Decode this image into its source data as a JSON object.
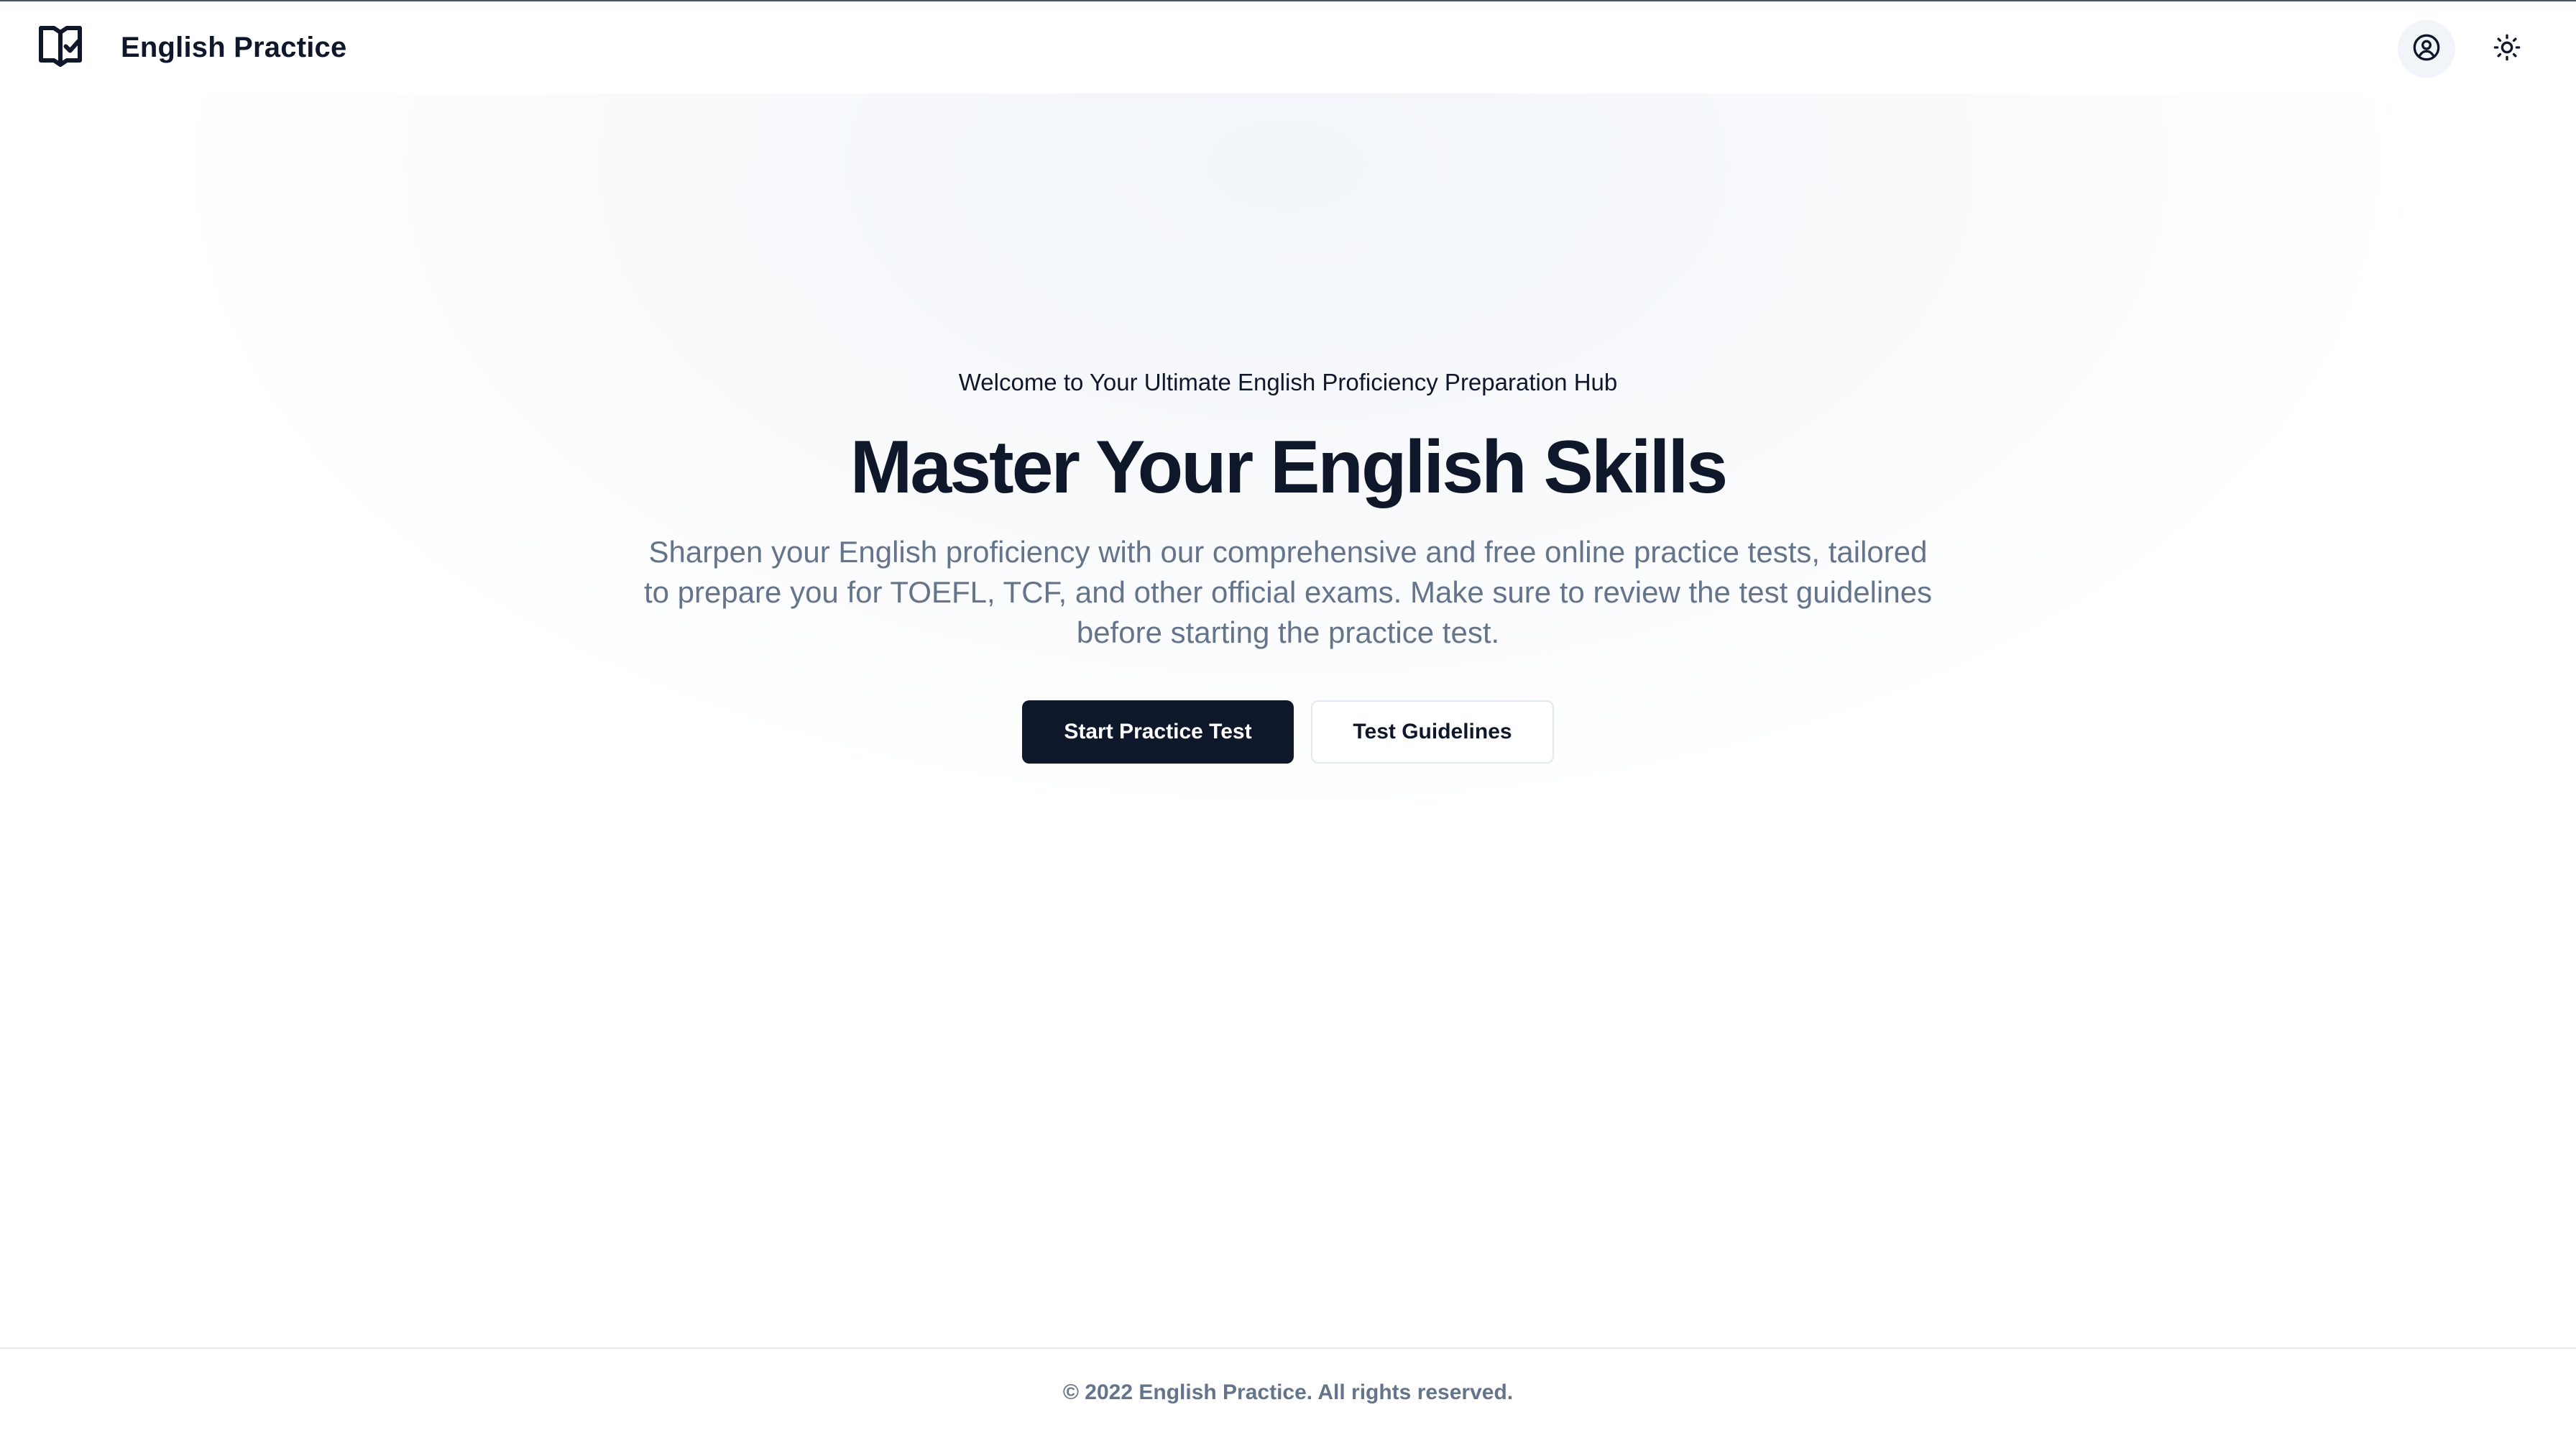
{
  "header": {
    "brand_name": "English Practice",
    "brand_icon": "book-check-icon",
    "user_icon": "user-circle-icon",
    "theme_icon": "sun-icon"
  },
  "hero": {
    "eyebrow": "Welcome to Your Ultimate English Proficiency Preparation Hub",
    "title": "Master Your English Skills",
    "description": "Sharpen your English proficiency with our comprehensive and free online practice tests, tailored to prepare you for TOEFL, TCF, and other official exams. Make sure to review the test guidelines before starting the practice test.",
    "primary_button": "Start Practice Test",
    "secondary_button": "Test Guidelines"
  },
  "footer": {
    "copyright": "© 2022 English Practice. All rights reserved."
  },
  "colors": {
    "primary": "#0f172a",
    "muted_text": "#64748b",
    "border": "#e2e8f0",
    "icon_bg": "#f1f5f9"
  }
}
